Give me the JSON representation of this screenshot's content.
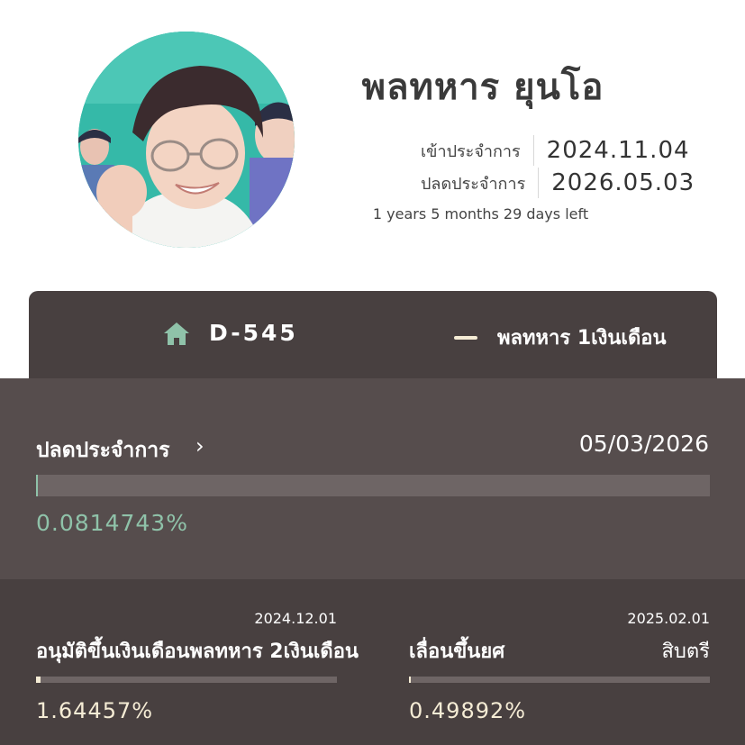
{
  "profile": {
    "name": "พลทหาร ยุนโอ",
    "enlist_label": "เข้าประจำการ",
    "enlist_date": "2024.11.04",
    "discharge_label": "ปลดประจำการ",
    "discharge_date": "2026.05.03",
    "time_left": "1 years 5 months 29 days left"
  },
  "tabs": {
    "dday": "D-545",
    "rank": "พลทหาร 1เงินเดือน"
  },
  "discharge_progress": {
    "title": "ปลดประจำการ",
    "date": "05/03/2026",
    "percent_text": "0.0814743%",
    "fraction": 0.000814743
  },
  "milestones": [
    {
      "date": "2024.12.01",
      "title": "อนุมัติขึ้นเงินเดือนพลทหาร 2เงินเดือน",
      "percent_text": "1.64457%",
      "fraction": 0.0164457
    },
    {
      "date": "2025.02.01",
      "title": "เลื่อนขึ้นยศ",
      "rank": "สิบตรี",
      "percent_text": "0.49892%",
      "fraction": 0.0049892
    }
  ],
  "colors": {
    "accent_green": "#8fc2a9",
    "cream": "#f5ecd5",
    "dark_panel": "#484040",
    "mid_panel": "#564d4d"
  }
}
